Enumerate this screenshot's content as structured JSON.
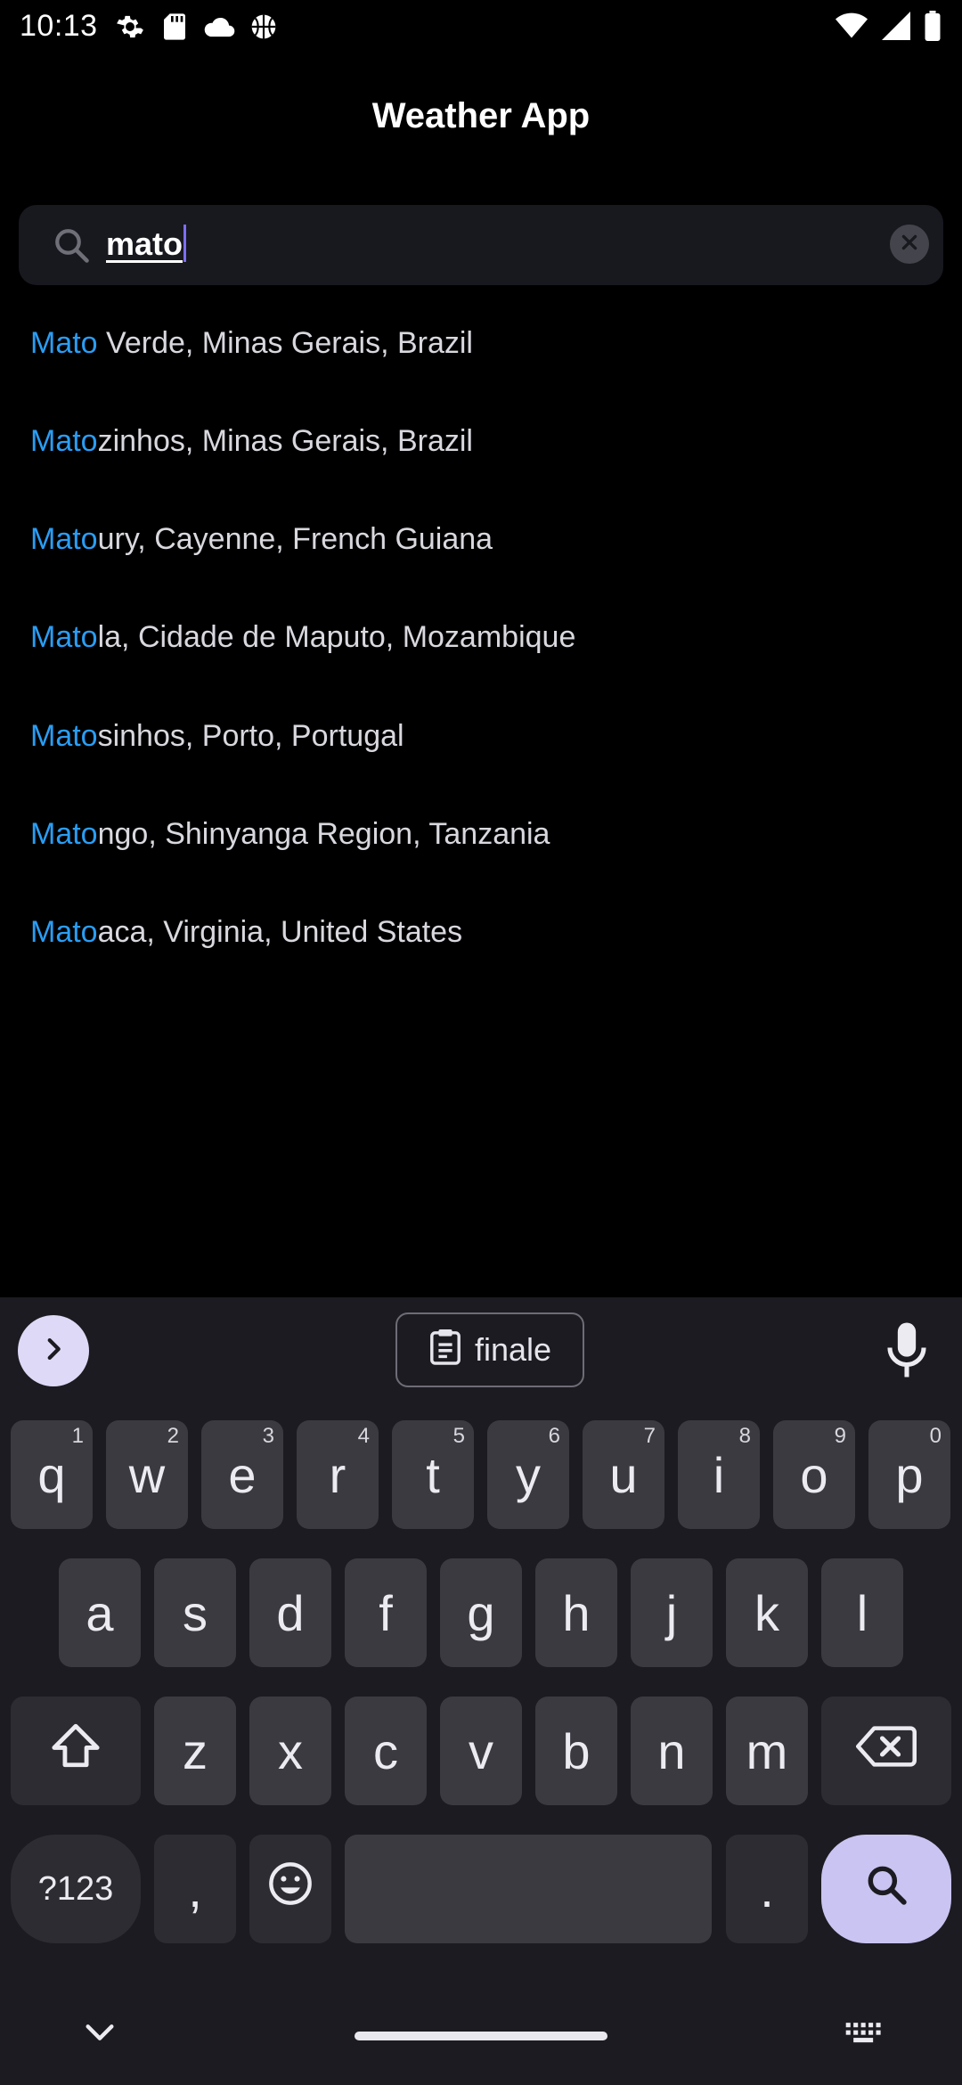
{
  "status_bar": {
    "time": "10:13",
    "left_icons": [
      "gear-icon",
      "sd-card-icon",
      "cloud-icon",
      "basketball-icon"
    ],
    "right_icons": [
      "wifi-icon",
      "signal-icon",
      "battery-icon"
    ]
  },
  "app": {
    "title": "Weather App"
  },
  "search": {
    "value": "mato",
    "icon": "search-icon",
    "clear_icon": "clear-icon"
  },
  "results": [
    {
      "match": "Mato",
      "rest": " Verde, Minas Gerais, Brazil"
    },
    {
      "match": "Mato",
      "rest": "zinhos, Minas Gerais, Brazil"
    },
    {
      "match": "Mato",
      "rest": "ury, Cayenne, French Guiana"
    },
    {
      "match": "Mato",
      "rest": "la, Cidade de Maputo, Mozambique"
    },
    {
      "match": "Mato",
      "rest": "sinhos, Porto, Portugal"
    },
    {
      "match": "Mato",
      "rest": "ngo, Shinyanga Region, Tanzania"
    },
    {
      "match": "Mato",
      "rest": "aca, Virginia, United States"
    }
  ],
  "colors": {
    "highlight": "#2a9df4",
    "background": "#000000",
    "keyboard_bg": "#1c1b21",
    "key_bg": "#3b3a41",
    "action_key": "#c9c4f1"
  },
  "keyboard": {
    "suggestion": "finale",
    "row1": [
      {
        "k": "q",
        "h": "1"
      },
      {
        "k": "w",
        "h": "2"
      },
      {
        "k": "e",
        "h": "3"
      },
      {
        "k": "r",
        "h": "4"
      },
      {
        "k": "t",
        "h": "5"
      },
      {
        "k": "y",
        "h": "6"
      },
      {
        "k": "u",
        "h": "7"
      },
      {
        "k": "i",
        "h": "8"
      },
      {
        "k": "o",
        "h": "9"
      },
      {
        "k": "p",
        "h": "0"
      }
    ],
    "row2": [
      "a",
      "s",
      "d",
      "f",
      "g",
      "h",
      "j",
      "k",
      "l"
    ],
    "row3": [
      "z",
      "x",
      "c",
      "v",
      "b",
      "n",
      "m"
    ],
    "symbols_label": "?123",
    "comma": ",",
    "period": "."
  }
}
